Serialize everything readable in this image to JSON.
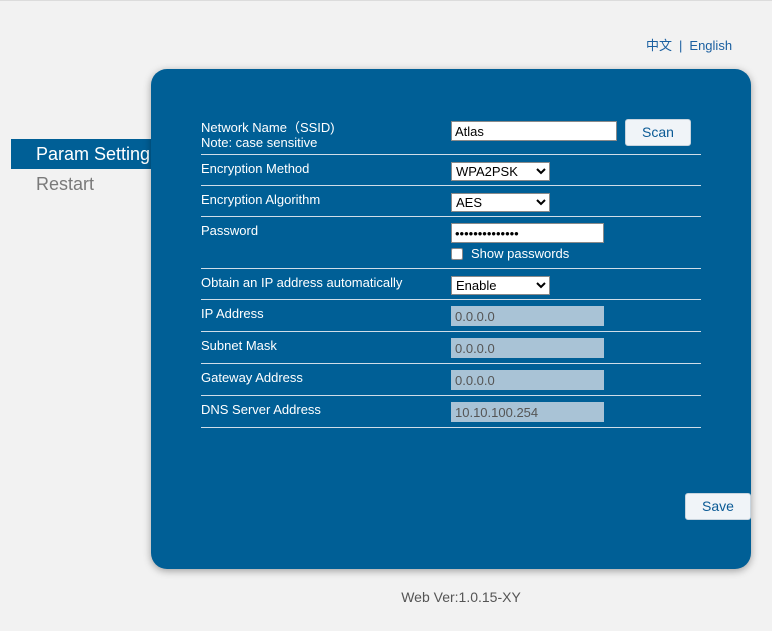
{
  "lang": {
    "zh": "中文",
    "separator": "|",
    "en": "English"
  },
  "menu": [
    {
      "label": "Param Setting",
      "active": true
    },
    {
      "label": "Restart",
      "active": false
    }
  ],
  "form": {
    "ssid": {
      "label": "Network Name（SSID)",
      "note": "Note: case sensitive",
      "value": "Atlas",
      "scan_label": "Scan"
    },
    "encryption_method": {
      "label": "Encryption Method",
      "value": "WPA2PSK"
    },
    "encryption_algorithm": {
      "label": "Encryption Algorithm",
      "value": "AES"
    },
    "password": {
      "label": "Password",
      "value": "••••••••••••••",
      "show_label": "Show passwords"
    },
    "dhcp": {
      "label": "Obtain an IP address automatically",
      "value": "Enable"
    },
    "ip_address": {
      "label": "IP Address",
      "value": "0.0.0.0"
    },
    "subnet_mask": {
      "label": "Subnet Mask",
      "value": "0.0.0.0"
    },
    "gateway": {
      "label": "Gateway Address",
      "value": "0.0.0.0"
    },
    "dns": {
      "label": "DNS Server Address",
      "value": "10.10.100.254"
    },
    "save_label": "Save"
  },
  "footer": {
    "version": "Web Ver:1.0.15-XY"
  },
  "colors": {
    "panel": "#005f96",
    "menu_active": "#005f96",
    "link": "#1a5fa0"
  }
}
